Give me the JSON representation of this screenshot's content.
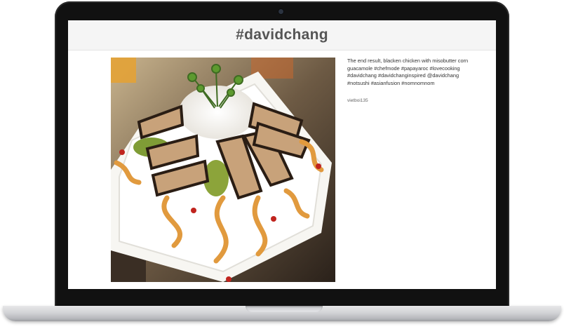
{
  "page": {
    "title": "#davidchang"
  },
  "post": {
    "caption": "The end result, blacken chicken with misobutter corn guacamole #chefmode #papayaroc #lovecooking #davidchang #davidchanginspired @davidchang #notsushi #asianfusion #nomnomnom",
    "username": "vietboi135"
  }
}
